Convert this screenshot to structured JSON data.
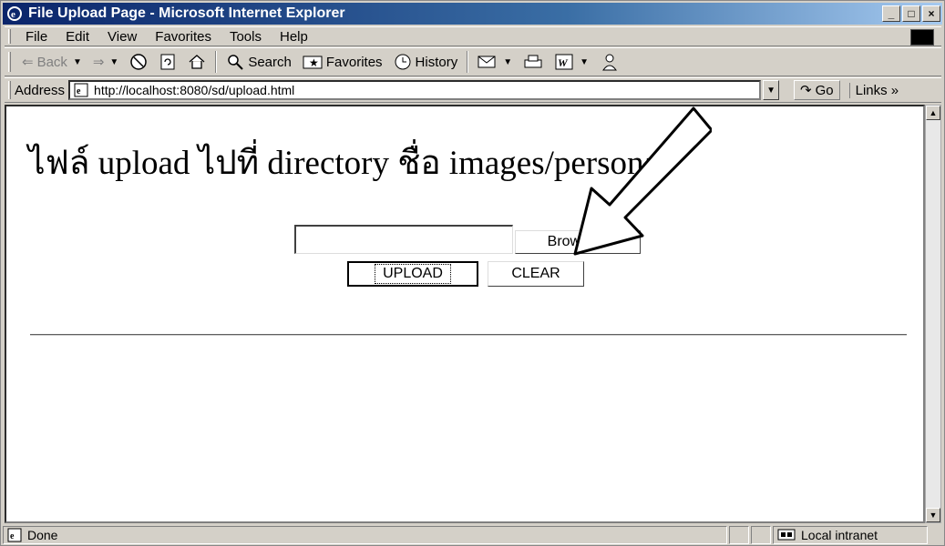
{
  "window": {
    "title": "File Upload Page - Microsoft Internet Explorer",
    "controls": [
      "_",
      "□",
      "×"
    ]
  },
  "menu": {
    "items": [
      "File",
      "Edit",
      "View",
      "Favorites",
      "Tools",
      "Help"
    ]
  },
  "toolbar": {
    "back": "Back",
    "search": "Search",
    "favorites": "Favorites",
    "history": "History"
  },
  "address": {
    "label": "Address",
    "url": "http://localhost:8080/sd/upload.html",
    "go": "Go",
    "links": "Links »"
  },
  "page": {
    "heading": "ไฟล์ upload ไปที่ directory ชื่อ images/personal",
    "browse_label": "Browse...",
    "upload_label": "UPLOAD",
    "clear_label": "CLEAR"
  },
  "status": {
    "text": "Done",
    "zone": "Local intranet"
  },
  "colors": {
    "title_bar_start": "#0a246a",
    "title_bar_end": "#a6caf0",
    "chrome": "#d4d0c8"
  }
}
